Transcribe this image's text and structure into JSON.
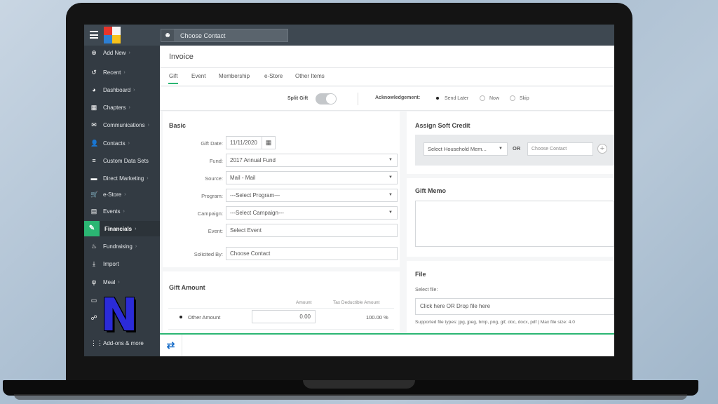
{
  "topbar": {
    "contact_placeholder": "Choose Contact"
  },
  "sidebar": {
    "items": [
      {
        "label": "Add New",
        "icon": "plus-circle-icon",
        "glyph": "⊕",
        "chevron": true
      },
      {
        "label": "Recent",
        "icon": "history-icon",
        "glyph": "↺",
        "chevron": true
      },
      {
        "label": "Dashboard",
        "icon": "dashboard-icon",
        "glyph": "◕",
        "chevron": true
      },
      {
        "label": "Chapters",
        "icon": "grid-icon",
        "glyph": "▦",
        "chevron": true
      },
      {
        "label": "Communications",
        "icon": "envelope-icon",
        "glyph": "✉",
        "chevron": true
      },
      {
        "label": "Contacts",
        "icon": "user-icon",
        "glyph": "👤",
        "chevron": true
      },
      {
        "label": "Custom Data Sets",
        "icon": "database-icon",
        "glyph": "≡",
        "chevron": false
      },
      {
        "label": "Direct Marketing",
        "icon": "car-icon",
        "glyph": "▬",
        "chevron": true
      },
      {
        "label": "e-Store",
        "icon": "cart-icon",
        "glyph": "🛒",
        "chevron": true
      },
      {
        "label": "Events",
        "icon": "calendar-icon",
        "glyph": "▤",
        "chevron": true
      },
      {
        "label": "Financials",
        "icon": "money-icon",
        "glyph": "✎",
        "chevron": true,
        "active": true
      },
      {
        "label": "Fundraising",
        "icon": "moneybag-icon",
        "glyph": "♨",
        "chevron": true
      },
      {
        "label": "Import",
        "icon": "import-icon",
        "glyph": "⤓",
        "chevron": false
      },
      {
        "label": "Meal",
        "icon": "utensils-icon",
        "glyph": "ψ",
        "chevron": true
      },
      {
        "label": "",
        "icon": "id-card-icon",
        "glyph": "▭",
        "chevron": false
      },
      {
        "label": "",
        "icon": "people-icon",
        "glyph": "☍",
        "chevron": false
      },
      {
        "label": "Add-ons & more",
        "icon": "apps-icon",
        "glyph": "⋮⋮",
        "chevron": false
      }
    ]
  },
  "overlay_letter": "N",
  "invoice": {
    "title": "Invoice",
    "tabs": [
      "Gift",
      "Event",
      "Membership",
      "e-Store",
      "Other Items"
    ],
    "split_gift_label": "Split Gift",
    "acknowledgement_label": "Acknowledgement:",
    "ack_options": [
      "Send Later",
      "Now",
      "Skip"
    ]
  },
  "basic": {
    "title": "Basic",
    "gift_date_label": "Gift Date:",
    "gift_date_value": "11/11/2020",
    "fund_label": "Fund:",
    "fund_value": "2017 Annual Fund",
    "source_label": "Source:",
    "source_value": "Mail - Mail",
    "program_label": "Program:",
    "program_value": "---Select Program---",
    "campaign_label": "Campaign:",
    "campaign_value": "---Select Campaign---",
    "event_label": "Event:",
    "event_placeholder": "Select Event",
    "solicited_label": "Solicited By:",
    "solicited_placeholder": "Choose Contact"
  },
  "gift_amount": {
    "title": "Gift Amount",
    "col_amount": "Amount",
    "col_tax": "Tax Deductible Amount",
    "row_label": "Other Amount",
    "row_amount": "0.00",
    "row_tax": "100.00 %"
  },
  "soft_credit": {
    "title": "Assign Soft Credit",
    "household_placeholder": "Select Household Mem...",
    "or_label": "OR",
    "contact_placeholder": "Choose Contact"
  },
  "gift_memo": {
    "title": "Gift Memo"
  },
  "file": {
    "title": "File",
    "select_label": "Select file:",
    "drop_text": "Click here OR Drop file here",
    "supported_text": "Supported file types: jpg, jpeg, bmp, png, gif, doc, docx, pdf | Max file size: 4.0"
  },
  "colors": {
    "accent": "#2bb673",
    "sidebar": "#333b43",
    "topbar": "#3e4851",
    "overlay_letter": "#2b2bd8"
  }
}
